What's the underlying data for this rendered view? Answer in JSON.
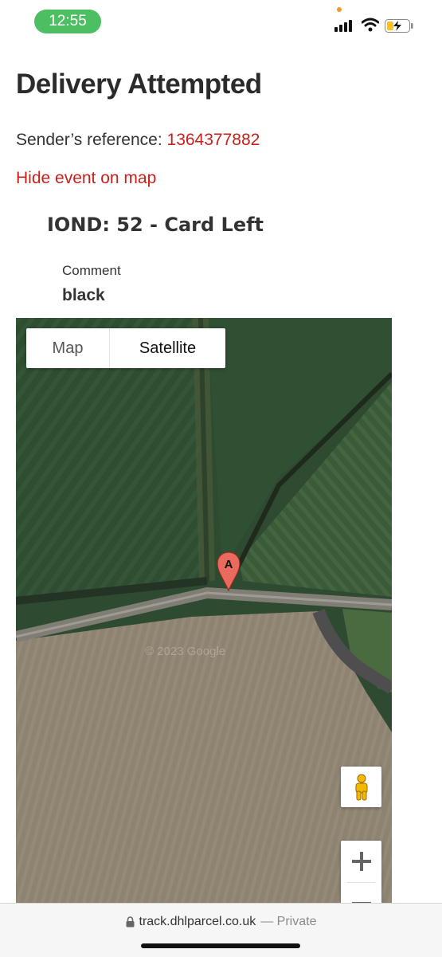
{
  "status_bar": {
    "time": "12:55",
    "icons": [
      "cellular-signal-icon",
      "wifi-icon",
      "battery-charging-icon"
    ],
    "time_pill_color": "#4cbf63"
  },
  "page": {
    "title": "Delivery Attempted",
    "sender_reference_label": "Sender’s reference:",
    "sender_reference_value": "1364377882",
    "hide_event_link": "Hide event on map",
    "event_heading": "IOND: 52 - Card Left",
    "comment_label": "Comment",
    "comment_value": "black",
    "accent_color": "#c8201b"
  },
  "map": {
    "type_control": {
      "map_label": "Map",
      "satellite_label": "Satellite",
      "selected": "Satellite"
    },
    "marker_label": "A",
    "watermark": "© 2023 Google",
    "controls": [
      "pegman-icon",
      "zoom-in-icon",
      "zoom-out-icon"
    ]
  },
  "browser": {
    "domain": "track.dhlparcel.co.uk",
    "mode": "— Private",
    "icon": "lock-icon"
  }
}
